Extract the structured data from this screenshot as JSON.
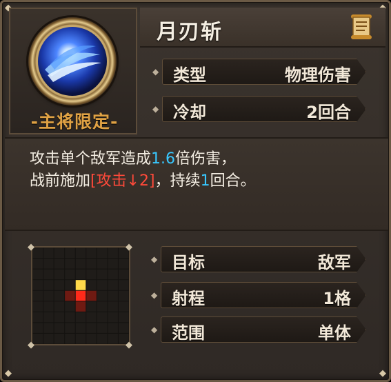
{
  "skill": {
    "name": "月刃斩",
    "restriction": "-主将限定-"
  },
  "stats_top": [
    {
      "label": "类型",
      "value": "物理伤害"
    },
    {
      "label": "冷却",
      "value": "2回合"
    }
  ],
  "description": {
    "line1_prefix": "攻击单个敌军造成",
    "line1_multiplier": "1.6",
    "line1_suffix": "倍伤害，",
    "line2_prefix": "战前施加",
    "line2_effect": "[攻击↓2]",
    "line2_mid": "，持续",
    "line2_turns": "1",
    "line2_suffix": "回合。"
  },
  "stats_bottom": [
    {
      "label": "目标",
      "value": "敌军"
    },
    {
      "label": "射程",
      "value": "1格"
    },
    {
      "label": "范围",
      "value": "单体"
    }
  ],
  "icons": {
    "skill_emblem": "blue-crescent-orb-icon",
    "detail": "scroll-icon",
    "row_marker": "diamond-icon"
  },
  "colors": {
    "restriction": "#e0a244",
    "highlight_blue": "#38c8ff",
    "highlight_red": "#ff4a3a"
  }
}
